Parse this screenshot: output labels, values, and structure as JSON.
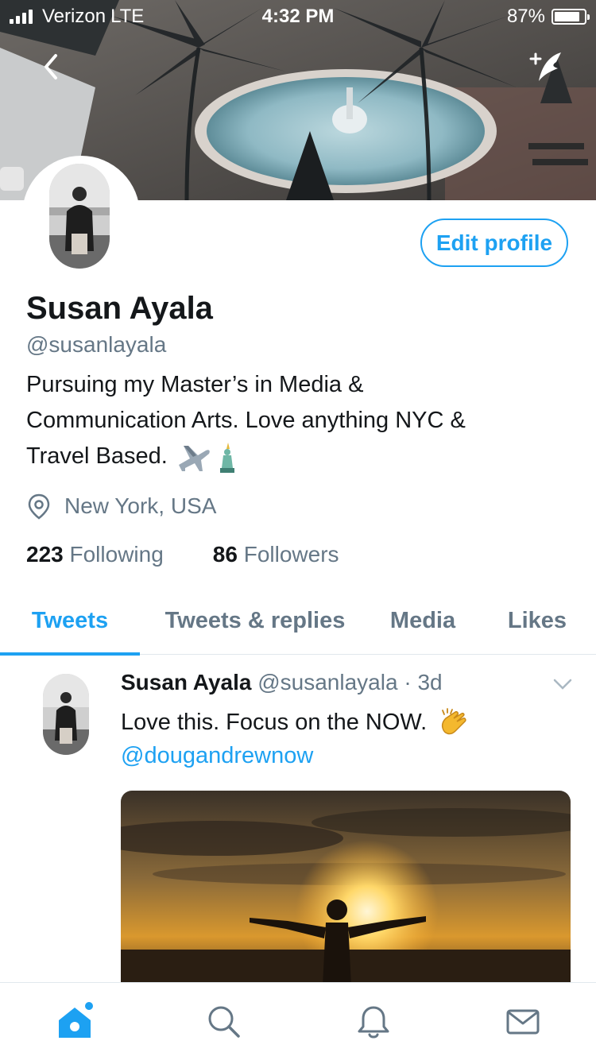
{
  "status_bar": {
    "carrier": "Verizon",
    "network": "LTE",
    "time": "4:32 PM",
    "battery_percent_label": "87%",
    "battery_level": 0.87
  },
  "header": {
    "back_icon": "chevron-left-icon",
    "compose_icon": "compose-tweet-icon"
  },
  "profile": {
    "display_name": "Susan Ayala",
    "handle": "@susanlayala",
    "bio_lines": [
      "Pursuing my Master’s in Media &",
      "Communication Arts. Love anything NYC &",
      "Travel Based."
    ],
    "bio_emojis": [
      "airplane-emoji",
      "statue-of-liberty-emoji"
    ],
    "location": "New York, USA",
    "edit_profile_label": "Edit profile",
    "following_count": "223",
    "following_label": "Following",
    "followers_count": "86",
    "followers_label": "Followers"
  },
  "tabs": [
    {
      "label": "Tweets",
      "active": true
    },
    {
      "label": "Tweets & replies",
      "active": false
    },
    {
      "label": "Media",
      "active": false
    },
    {
      "label": "Likes",
      "active": false
    }
  ],
  "tweet": {
    "author_name": "Susan Ayala",
    "author_handle": "@susanlayala",
    "separator": "·",
    "time_ago": "3d",
    "text": "Love this. Focus on the NOW.",
    "emoji": "clapping-hands-emoji",
    "mention": "@dougandrewnow"
  },
  "bottom_nav": [
    {
      "icon": "home-icon",
      "active": true,
      "has_badge": true
    },
    {
      "icon": "search-icon",
      "active": false
    },
    {
      "icon": "notifications-bell-icon",
      "active": false
    },
    {
      "icon": "messages-envelope-icon",
      "active": false
    }
  ],
  "colors": {
    "accent": "#1da1f2",
    "secondary_text": "#657786",
    "primary_text": "#14171a",
    "divider": "#e1e8ed"
  }
}
